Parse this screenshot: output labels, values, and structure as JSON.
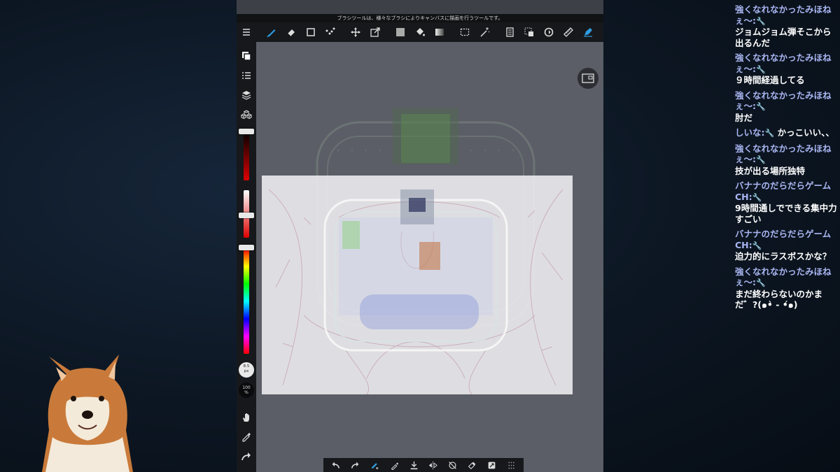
{
  "app": {
    "hint_text": "ブラシツールは、様々なブラシによりキャンバスに描画を行うツールです。",
    "brush_size_value": "8.5",
    "brush_size_unit": "px",
    "opacity_value": "100",
    "opacity_unit": "%",
    "toolbar": [
      {
        "name": "brush-tool",
        "icon": "brush-icon",
        "active": true
      },
      {
        "name": "eraser-tool",
        "icon": "eraser-icon"
      },
      {
        "name": "shape-tool",
        "icon": "square-icon"
      },
      {
        "name": "dot-tool",
        "icon": "dots-icon"
      },
      {
        "name": "move-tool",
        "icon": "move-icon"
      },
      {
        "name": "transform-tool",
        "icon": "transform-icon"
      },
      {
        "name": "fill-color-tool",
        "icon": "fill-square-icon"
      },
      {
        "name": "bucket-tool",
        "icon": "bucket-icon"
      },
      {
        "name": "gradient-tool",
        "icon": "gradient-icon"
      },
      {
        "name": "select-tool",
        "icon": "marquee-icon"
      },
      {
        "name": "magic-wand-tool",
        "icon": "magic-wand-icon"
      },
      {
        "name": "copy-tool",
        "icon": "pages-icon"
      },
      {
        "name": "select-layer-tool",
        "icon": "select-layer-icon"
      },
      {
        "name": "rotate-tool",
        "icon": "rotate-icon"
      },
      {
        "name": "ruler-tool",
        "icon": "ruler-icon"
      },
      {
        "name": "pen-setting-tool",
        "icon": "pen-nib-icon"
      }
    ],
    "accent_color": "#2f9be0",
    "sidebar_bg": "#16181b",
    "workspace_bg": "#5b5e66"
  },
  "chat": {
    "author_color": "#a9b6f2",
    "messages": [
      {
        "author": "強くなれなかったみほねぇ〜:",
        "text": "ジョムジョム弾そこから出るんだ"
      },
      {
        "author": "強くなれなかったみほねぇ〜:",
        "text": "９時間経過してる"
      },
      {
        "author": "強くなれなかったみほねぇ〜:",
        "text": "肘だ"
      },
      {
        "author": "しいな:",
        "text": "かっこいい、、"
      },
      {
        "author": "強くなれなかったみほねぇ〜:",
        "text": "技が出る場所独特"
      },
      {
        "author": "バナナのだらだらゲームCH:",
        "text": "9時間通しでできる集中力すごい"
      },
      {
        "author": "バナナのだらだらゲームCH:",
        "text": "迫力的にラスボスかな？"
      },
      {
        "author": "強くなれなかったみほねぇ〜:",
        "text": "まだ終わらないのかまだ゛?(๑•̀ - •́๑)"
      }
    ]
  }
}
